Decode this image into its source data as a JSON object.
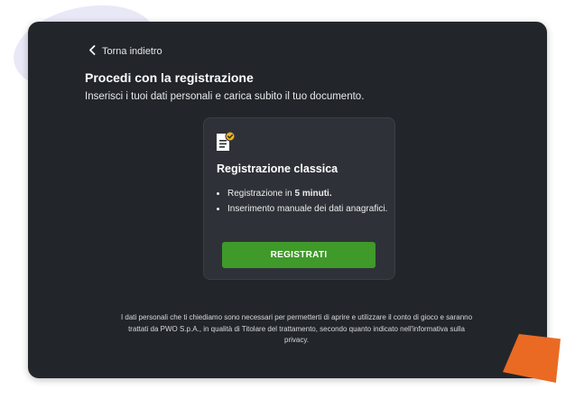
{
  "nav": {
    "back_label": "Torna indietro"
  },
  "header": {
    "title": "Procedi con la registrazione",
    "subtitle": "Inserisci i tuoi dati personali e carica subito il tuo documento."
  },
  "card": {
    "icon": "document-check-icon",
    "title": "Registrazione classica",
    "bullet1_prefix": "Registrazione in ",
    "bullet1_bold": "5 minuti.",
    "bullet2": "Inserimento manuale dei dati anagrafici.",
    "button_label": "REGISTRATI"
  },
  "footer": {
    "privacy_note": "I dati personali che ti chiediamo sono necessari per permetterti di aprire e utilizzare il conto di gioco e saranno trattati da PWO S.p.A., in qualità di Titolare del trattamento, secondo quanto indicato nell'informativa sulla privacy."
  },
  "colors": {
    "panel_bg": "#22262b",
    "card_bg": "#2e3238",
    "accent_green": "#3f9a2a",
    "icon_yellow": "#f2b21c",
    "decor_orange": "#ea6a24"
  }
}
